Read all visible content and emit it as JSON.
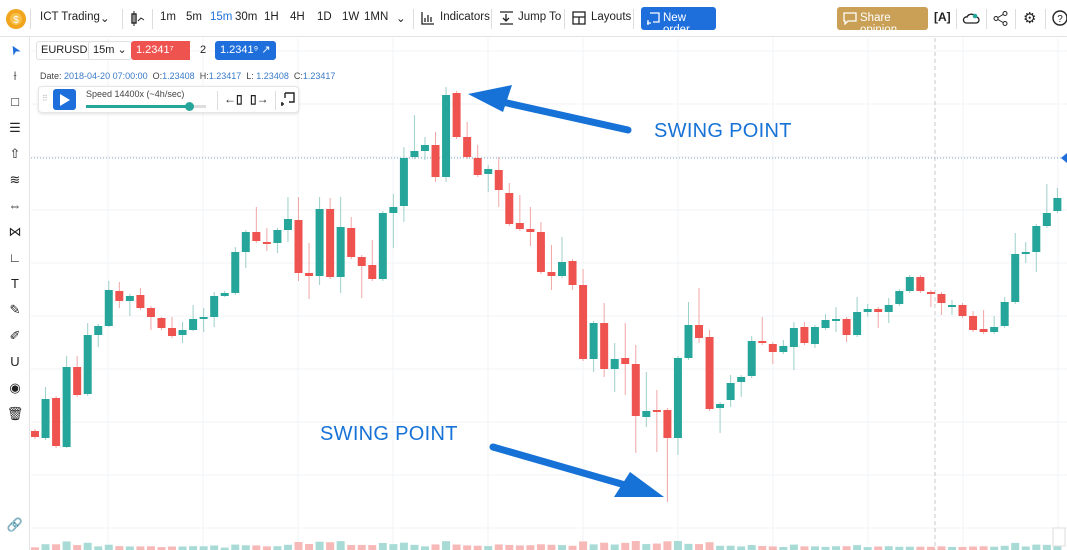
{
  "header": {
    "app_name": "ICT Trading",
    "timeframes": [
      "1m",
      "5m",
      "15m",
      "30m",
      "1H",
      "4H",
      "1D",
      "1W",
      "1MN"
    ],
    "active_timeframe": "15m",
    "indicators_label": "Indicators",
    "jump_to_label": "Jump To",
    "layouts_label": "Layouts",
    "new_order_label": "New order",
    "share_opinion_label": "Share opinion"
  },
  "legend": {
    "symbol": "EURUSD",
    "interval": "15m",
    "sell_price": "1.2341⁷",
    "spread": "2",
    "buy_price": "1.2341⁹",
    "date_label": "Date:",
    "date": "2018-04-20 07:00:00",
    "o_label": "O:",
    "o": "1.23408",
    "h_label": "H:",
    "h": "1.23417",
    "l_label": "L:",
    "l": "1.23408",
    "c_label": "C:",
    "c": "1.23417"
  },
  "replay": {
    "speed_label": "Speed 14400x (~4h/sec)",
    "speed_fraction": 0.86
  },
  "annotations": {
    "top": "SWING POINT",
    "bottom": "SWING POINT"
  },
  "colors": {
    "up": "#26a69a",
    "down": "#ef5350",
    "accent": "#1e6fdc",
    "share": "#c9a055",
    "annotation": "#1672d6"
  },
  "left_tools": [
    "cursor-icon",
    "trend-line-icon",
    "rectangle-icon",
    "fib-icon",
    "arrow-up-icon",
    "channel-icon",
    "measure-icon",
    "pattern-icon",
    "elliott-icon",
    "text-icon",
    "brush-icon",
    "pencil-icon",
    "magnet-icon",
    "eye-icon",
    "trash-icon"
  ],
  "chart_data": {
    "type": "candlestick",
    "symbol": "EURUSD",
    "interval": "15m",
    "price_line": 1.23452,
    "ohlc": [
      [
        1.23179,
        1.23181,
        1.23171,
        1.23173
      ],
      [
        1.23172,
        1.23223,
        1.2317,
        1.23211
      ],
      [
        1.23212,
        1.23214,
        1.23162,
        1.23164
      ],
      [
        1.23163,
        1.23254,
        1.23162,
        1.23243
      ],
      [
        1.23243,
        1.23254,
        1.23213,
        1.23215
      ],
      [
        1.23216,
        1.23287,
        1.23214,
        1.23275
      ],
      [
        1.23275,
        1.23286,
        1.23263,
        1.23284
      ],
      [
        1.23284,
        1.23329,
        1.23283,
        1.2332
      ],
      [
        1.23319,
        1.23328,
        1.23302,
        1.23309
      ],
      [
        1.23309,
        1.23316,
        1.23294,
        1.23314
      ],
      [
        1.23315,
        1.23322,
        1.233,
        1.23302
      ],
      [
        1.23302,
        1.23304,
        1.2328,
        1.23293
      ],
      [
        1.23292,
        1.23293,
        1.2328,
        1.23282
      ],
      [
        1.23282,
        1.23293,
        1.23272,
        1.23274
      ],
      [
        1.23275,
        1.23288,
        1.23267,
        1.2328
      ],
      [
        1.2328,
        1.23305,
        1.23279,
        1.23291
      ],
      [
        1.23292,
        1.23302,
        1.23278,
        1.23293
      ],
      [
        1.23293,
        1.23318,
        1.23283,
        1.23314
      ],
      [
        1.23314,
        1.23319,
        1.23313,
        1.23317
      ],
      [
        1.23317,
        1.23363,
        1.23315,
        1.23358
      ],
      [
        1.23358,
        1.2338,
        1.23342,
        1.23378
      ],
      [
        1.23378,
        1.23403,
        1.23367,
        1.23369
      ],
      [
        1.23368,
        1.23382,
        1.23359,
        1.23367
      ],
      [
        1.23367,
        1.23382,
        1.23357,
        1.2338
      ],
      [
        1.2338,
        1.23413,
        1.23368,
        1.23391
      ],
      [
        1.2339,
        1.23413,
        1.23329,
        1.23337
      ],
      [
        1.23337,
        1.23367,
        1.23311,
        1.23334
      ],
      [
        1.23334,
        1.23413,
        1.23325,
        1.23401
      ],
      [
        1.23401,
        1.23412,
        1.23331,
        1.23333
      ],
      [
        1.23333,
        1.23413,
        1.23317,
        1.23383
      ],
      [
        1.23382,
        1.23393,
        1.23351,
        1.23353
      ],
      [
        1.23353,
        1.23355,
        1.23312,
        1.23344
      ],
      [
        1.23345,
        1.2337,
        1.23329,
        1.23331
      ],
      [
        1.23331,
        1.23399,
        1.23329,
        1.23397
      ],
      [
        1.23397,
        1.23416,
        1.23362,
        1.23403
      ],
      [
        1.23404,
        1.23463,
        1.23388,
        1.23452
      ],
      [
        1.23453,
        1.23495,
        1.23451,
        1.23459
      ],
      [
        1.23459,
        1.23473,
        1.2345,
        1.23465
      ],
      [
        1.23465,
        1.23478,
        1.23428,
        1.23433
      ],
      [
        1.23433,
        1.23523,
        1.23428,
        1.23515
      ],
      [
        1.23517,
        1.23519,
        1.23471,
        1.23473
      ],
      [
        1.23473,
        1.23488,
        1.23451,
        1.23453
      ],
      [
        1.23452,
        1.23465,
        1.23433,
        1.23435
      ],
      [
        1.23436,
        1.23445,
        1.23418,
        1.23441
      ],
      [
        1.2344,
        1.23453,
        1.23403,
        1.2342
      ],
      [
        1.23417,
        1.23427,
        1.23384,
        1.23386
      ],
      [
        1.23387,
        1.23415,
        1.23379,
        1.23381
      ],
      [
        1.23381,
        1.23403,
        1.23364,
        1.23378
      ],
      [
        1.23378,
        1.23388,
        1.23336,
        1.23338
      ],
      [
        1.23338,
        1.23365,
        1.2332,
        1.23334
      ],
      [
        1.23334,
        1.23373,
        1.23332,
        1.23348
      ],
      [
        1.23349,
        1.23351,
        1.2332,
        1.23325
      ],
      [
        1.23325,
        1.23341,
        1.23249,
        1.23251
      ],
      [
        1.23251,
        1.23289,
        1.23238,
        1.23287
      ],
      [
        1.23287,
        1.23307,
        1.23233,
        1.23241
      ],
      [
        1.23241,
        1.23267,
        1.23218,
        1.23251
      ],
      [
        1.23252,
        1.23287,
        1.23215,
        1.23246
      ],
      [
        1.23246,
        1.23265,
        1.23157,
        1.23194
      ],
      [
        1.23193,
        1.23238,
        1.23183,
        1.23199
      ],
      [
        1.232,
        1.2322,
        1.23158,
        1.23199
      ],
      [
        1.232,
        1.23202,
        1.23108,
        1.23172
      ],
      [
        1.23172,
        1.23254,
        1.23155,
        1.23252
      ],
      [
        1.23252,
        1.23308,
        1.2325,
        1.23285
      ],
      [
        1.23285,
        1.23322,
        1.23267,
        1.23272
      ],
      [
        1.23273,
        1.2328,
        1.23199,
        1.23201
      ],
      [
        1.23202,
        1.23208,
        1.23177,
        1.23206
      ],
      [
        1.2321,
        1.23235,
        1.23203,
        1.23227
      ],
      [
        1.23228,
        1.23235,
        1.23213,
        1.23233
      ],
      [
        1.23234,
        1.23274,
        1.23232,
        1.23269
      ],
      [
        1.23269,
        1.23293,
        1.23265,
        1.23267
      ],
      [
        1.23266,
        1.23268,
        1.23246,
        1.23258
      ],
      [
        1.23258,
        1.2327,
        1.23256,
        1.23264
      ],
      [
        1.23263,
        1.23288,
        1.2324,
        1.23282
      ],
      [
        1.23283,
        1.23288,
        1.23265,
        1.23267
      ],
      [
        1.23266,
        1.23285,
        1.23262,
        1.23283
      ],
      [
        1.23282,
        1.23296,
        1.2328,
        1.2329
      ],
      [
        1.23291,
        1.23303,
        1.23278,
        1.23291
      ],
      [
        1.23291,
        1.23293,
        1.23268,
        1.23275
      ],
      [
        1.23275,
        1.23313,
        1.23273,
        1.23298
      ],
      [
        1.23298,
        1.23306,
        1.23293,
        1.23301
      ],
      [
        1.23301,
        1.23303,
        1.23282,
        1.23298
      ],
      [
        1.23298,
        1.23312,
        1.23287,
        1.23305
      ],
      [
        1.23306,
        1.23321,
        1.23304,
        1.23319
      ],
      [
        1.23319,
        1.23335,
        1.23317,
        1.23333
      ],
      [
        1.23333,
        1.23335,
        1.23317,
        1.23319
      ],
      [
        1.23318,
        1.2332,
        1.23303,
        1.23317
      ],
      [
        1.23316,
        1.23318,
        1.23295,
        1.23307
      ],
      [
        1.23305,
        1.2331,
        1.23295,
        1.23305
      ],
      [
        1.23305,
        1.23307,
        1.23292,
        1.23294
      ],
      [
        1.23294,
        1.23299,
        1.23278,
        1.2328
      ],
      [
        1.23281,
        1.233,
        1.23276,
        1.23278
      ],
      [
        1.23278,
        1.23294,
        1.23276,
        1.23283
      ],
      [
        1.23284,
        1.23313,
        1.23282,
        1.23308
      ],
      [
        1.23308,
        1.23377,
        1.23306,
        1.23356
      ],
      [
        1.23357,
        1.23368,
        1.23347,
        1.23358
      ],
      [
        1.23358,
        1.23386,
        1.23338,
        1.23384
      ],
      [
        1.23384,
        1.23426,
        1.23382,
        1.23397
      ],
      [
        1.23399,
        1.23422,
        1.23397,
        1.23412
      ]
    ]
  }
}
